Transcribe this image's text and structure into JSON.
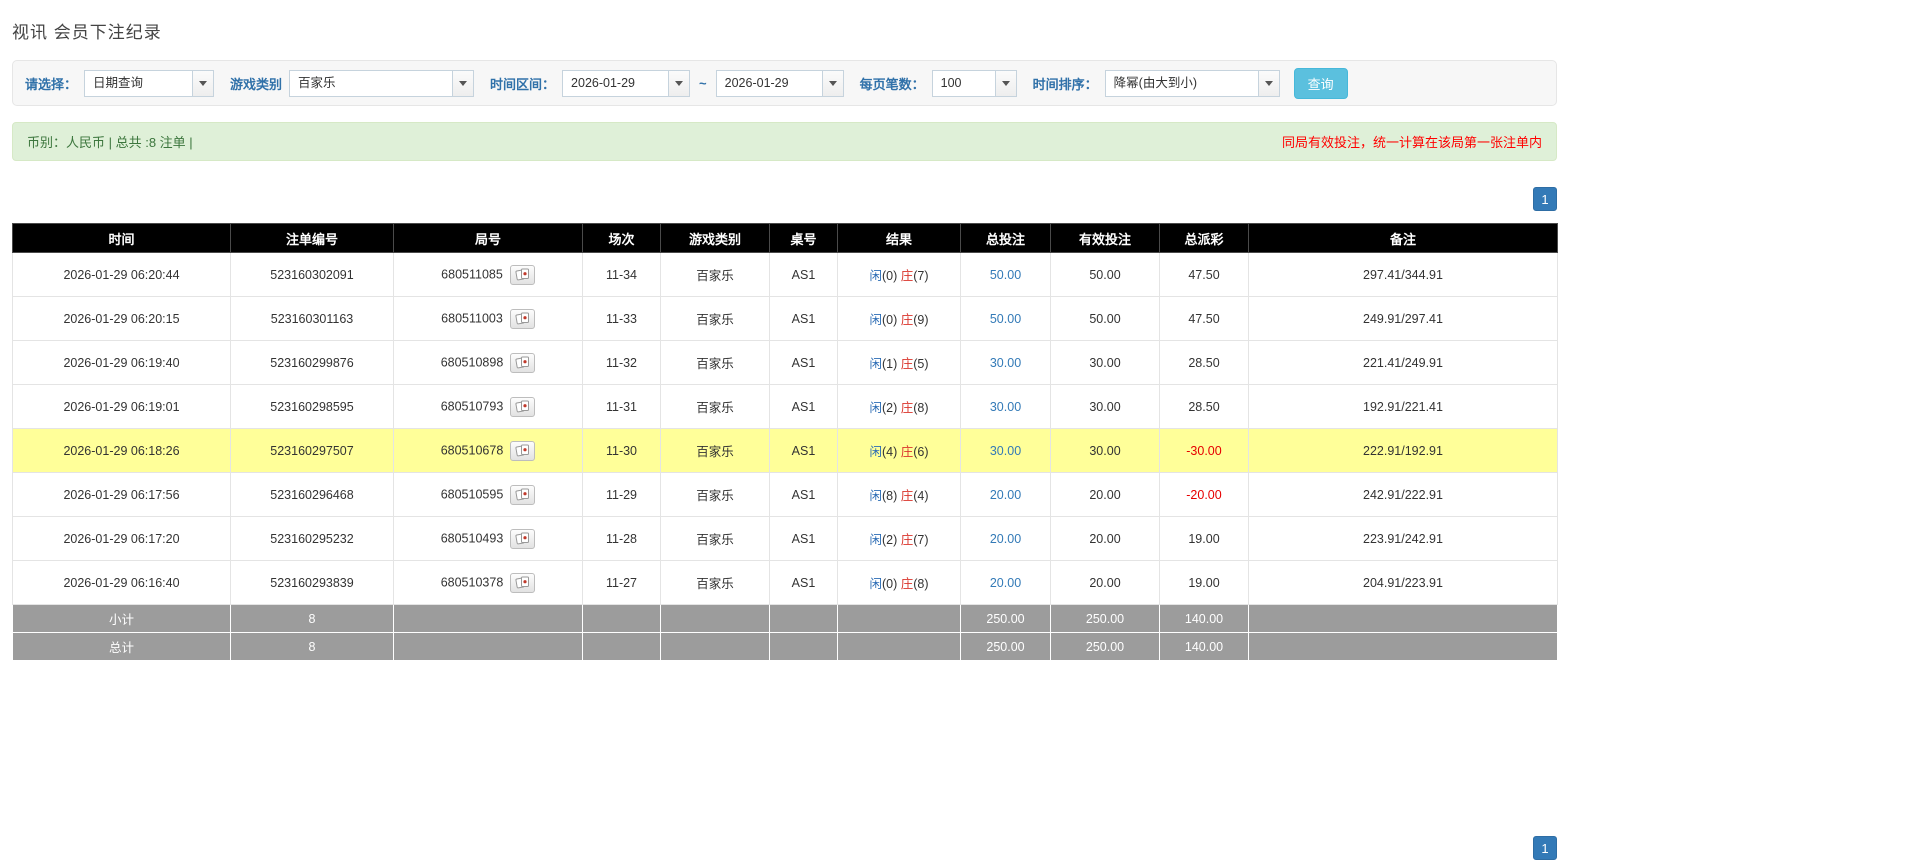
{
  "page": {
    "title": "视讯 会员下注纪录"
  },
  "filter_bar": {
    "select_label": "请选择：",
    "select_value": "日期查询",
    "game_type_label": "游戏类别",
    "game_type_value": "百家乐",
    "time_range_label": "时间区间：",
    "date_from": "2026-01-29",
    "range_separator": "~",
    "date_to": "2026-01-29",
    "per_page_label": "每页笔数：",
    "per_page_value": "100",
    "sort_label": "时间排序：",
    "sort_value": "降幂(由大到小)",
    "search_button_label": "查询"
  },
  "summary_bar": {
    "left_text": "币别：人民币 | 总共 :8 注单 |",
    "right_text": "同局有效投注，统一计算在该局第一张注单内"
  },
  "pagination": {
    "current_page": "1"
  },
  "table": {
    "headers": [
      "时间",
      "注单编号",
      "局号",
      "场次",
      "游戏类别",
      "桌号",
      "结果",
      "总投注",
      "有效投注",
      "总派彩",
      "备注"
    ],
    "rows": [
      {
        "time": "2026-01-29 06:20:44",
        "bet_id": "523160302091",
        "round_no": "680511085",
        "session": "11-34",
        "game_type": "百家乐",
        "table_no": "AS1",
        "player_label": "闲",
        "player_score": "(0)",
        "banker_label": "庄",
        "banker_score": "(7)",
        "total_bet": "50.00",
        "valid_bet": "50.00",
        "total_payout": "47.50",
        "remark": "297.41/344.91",
        "highlight": false
      },
      {
        "time": "2026-01-29 06:20:15",
        "bet_id": "523160301163",
        "round_no": "680511003",
        "session": "11-33",
        "game_type": "百家乐",
        "table_no": "AS1",
        "player_label": "闲",
        "player_score": "(0)",
        "banker_label": "庄",
        "banker_score": "(9)",
        "total_bet": "50.00",
        "valid_bet": "50.00",
        "total_payout": "47.50",
        "remark": "249.91/297.41",
        "highlight": false
      },
      {
        "time": "2026-01-29 06:19:40",
        "bet_id": "523160299876",
        "round_no": "680510898",
        "session": "11-32",
        "game_type": "百家乐",
        "table_no": "AS1",
        "player_label": "闲",
        "player_score": "(1)",
        "banker_label": "庄",
        "banker_score": "(5)",
        "total_bet": "30.00",
        "valid_bet": "30.00",
        "total_payout": "28.50",
        "remark": "221.41/249.91",
        "highlight": false
      },
      {
        "time": "2026-01-29 06:19:01",
        "bet_id": "523160298595",
        "round_no": "680510793",
        "session": "11-31",
        "game_type": "百家乐",
        "table_no": "AS1",
        "player_label": "闲",
        "player_score": "(2)",
        "banker_label": "庄",
        "banker_score": "(8)",
        "total_bet": "30.00",
        "valid_bet": "30.00",
        "total_payout": "28.50",
        "remark": "192.91/221.41",
        "highlight": false
      },
      {
        "time": "2026-01-29 06:18:26",
        "bet_id": "523160297507",
        "round_no": "680510678",
        "session": "11-30",
        "game_type": "百家乐",
        "table_no": "AS1",
        "player_label": "闲",
        "player_score": "(4)",
        "banker_label": "庄",
        "banker_score": "(6)",
        "total_bet": "30.00",
        "valid_bet": "30.00",
        "total_payout": "-30.00",
        "remark": "222.91/192.91",
        "highlight": true
      },
      {
        "time": "2026-01-29 06:17:56",
        "bet_id": "523160296468",
        "round_no": "680510595",
        "session": "11-29",
        "game_type": "百家乐",
        "table_no": "AS1",
        "player_label": "闲",
        "player_score": "(8)",
        "banker_label": "庄",
        "banker_score": "(4)",
        "total_bet": "20.00",
        "valid_bet": "20.00",
        "total_payout": "-20.00",
        "remark": "242.91/222.91",
        "highlight": false
      },
      {
        "time": "2026-01-29 06:17:20",
        "bet_id": "523160295232",
        "round_no": "680510493",
        "session": "11-28",
        "game_type": "百家乐",
        "table_no": "AS1",
        "player_label": "闲",
        "player_score": "(2)",
        "banker_label": "庄",
        "banker_score": "(7)",
        "total_bet": "20.00",
        "valid_bet": "20.00",
        "total_payout": "19.00",
        "remark": "223.91/242.91",
        "highlight": false
      },
      {
        "time": "2026-01-29 06:16:40",
        "bet_id": "523160293839",
        "round_no": "680510378",
        "session": "11-27",
        "game_type": "百家乐",
        "table_no": "AS1",
        "player_label": "闲",
        "player_score": "(0)",
        "banker_label": "庄",
        "banker_score": "(8)",
        "total_bet": "20.00",
        "valid_bet": "20.00",
        "total_payout": "19.00",
        "remark": "204.91/223.91",
        "highlight": false
      }
    ],
    "subtotal_row": {
      "label": "小计",
      "count": "8",
      "total_bet": "250.00",
      "valid_bet": "250.00",
      "total_payout": "140.00"
    },
    "total_row": {
      "label": "总计",
      "count": "8",
      "total_bet": "250.00",
      "valid_bet": "250.00",
      "total_payout": "140.00"
    }
  },
  "colors": {
    "player_blue": "#2b6cb5",
    "banker_red": "#d9342b",
    "bet_link_blue": "#337ab7",
    "negative_red": "#e60000",
    "highlight_yellow": "#ffff99",
    "table_header_bg": "#000000",
    "footer_row_bg": "#9c9c9c",
    "search_button_bg": "#5bc0de",
    "pagination_bg": "#337ab7",
    "summary_bg": "#dff0d8",
    "summary_text_green": "#3c763d",
    "warning_red": "#ff0000",
    "filter_label_blue": "#3071a9"
  }
}
